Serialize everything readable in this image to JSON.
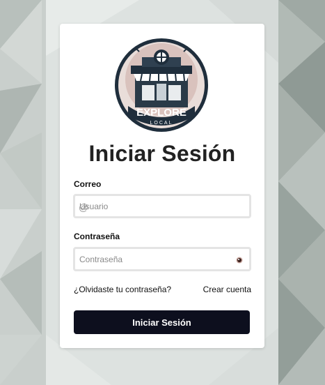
{
  "logo": {
    "line1": "EXPLORE",
    "line2": "LOCAL"
  },
  "title": "Iniciar Sesión",
  "email": {
    "label": "Correo",
    "placeholder": "Usuario",
    "icon": "at-icon"
  },
  "password": {
    "label": "Contraseña",
    "placeholder": "Contraseña",
    "icon": "eye-icon"
  },
  "links": {
    "forgot": "¿Olvidaste tu contraseña?",
    "create": "Crear cuenta"
  },
  "submit_label": "Iniciar Sesión",
  "colors": {
    "button": "#0d0f1e",
    "card": "#ffffff",
    "background": "#c7cdca"
  }
}
